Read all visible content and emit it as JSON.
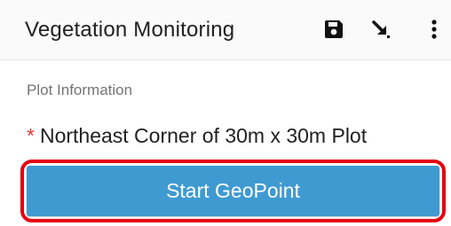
{
  "app_bar": {
    "title": "Vegetation Monitoring",
    "icons": [
      "save-icon",
      "go-to-question-icon",
      "more-vert-icon"
    ]
  },
  "form": {
    "group_label": "Plot Information",
    "question": {
      "required_marker": "*",
      "label": "Northeast Corner of 30m x 30m Plot"
    },
    "action_button_label": "Start GeoPoint"
  },
  "colors": {
    "app_bar_background": "#fafafa",
    "button_background": "#3f9ad2",
    "required_marker": "#e53935",
    "highlight_outline": "#e4000f"
  }
}
